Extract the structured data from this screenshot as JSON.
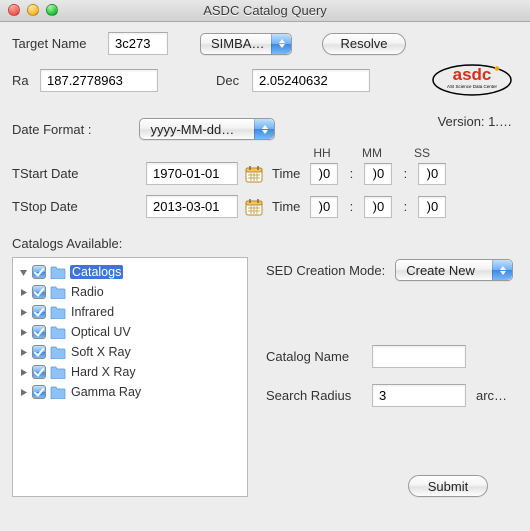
{
  "window": {
    "title": "ASDC Catalog Query"
  },
  "logo": {
    "text_main": "asdc",
    "text_sub": "ASI Science Data Center"
  },
  "version_label": "Version: 1.…",
  "target": {
    "label": "Target Name",
    "value": "3c273",
    "resolver_options_label": "SIMBA…",
    "resolve_button": "Resolve"
  },
  "coords": {
    "ra_label": "Ra",
    "ra_value": "187.2778963",
    "dec_label": "Dec",
    "dec_value": "2.05240632"
  },
  "dateformat": {
    "label": "Date Format  :",
    "value": "yyyy-MM-dd…"
  },
  "time_headers": {
    "hh": "HH",
    "mm": "MM",
    "ss": "SS"
  },
  "tstart": {
    "label": "TStart Date",
    "date": "1970-01-01",
    "time_label": "Time",
    "hh": ")0",
    "mm": ")0",
    "ss": ")0"
  },
  "tstop": {
    "label": "TStop Date",
    "date": "2013-03-01",
    "time_label": "Time",
    "hh": ")0",
    "mm": ")0",
    "ss": ")0"
  },
  "catalogs": {
    "label": "Catalogs Available:",
    "items": [
      {
        "label": "Catalogs",
        "selected": true,
        "expanded": true
      },
      {
        "label": "Radio",
        "selected": false,
        "expanded": false
      },
      {
        "label": "Infrared",
        "selected": false,
        "expanded": false
      },
      {
        "label": "Optical UV",
        "selected": false,
        "expanded": false
      },
      {
        "label": "Soft X Ray",
        "selected": false,
        "expanded": false
      },
      {
        "label": "Hard X Ray",
        "selected": false,
        "expanded": false
      },
      {
        "label": "Gamma Ray",
        "selected": false,
        "expanded": false
      }
    ]
  },
  "sed": {
    "label": "SED Creation Mode:",
    "value": "Create New"
  },
  "catalog_name": {
    "label": "Catalog Name",
    "value": ""
  },
  "search_radius": {
    "label": "Search Radius",
    "value": "3",
    "unit": "arc…"
  },
  "submit_label": "Submit",
  "separators": {
    "colon": ":"
  }
}
